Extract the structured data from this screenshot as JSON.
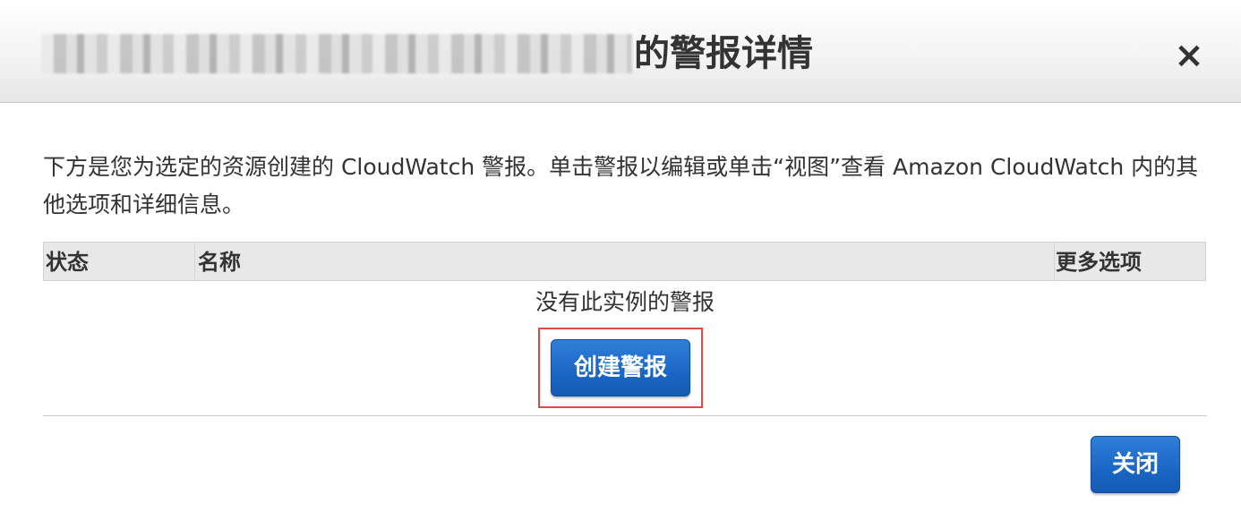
{
  "dialog": {
    "title_suffix": "的警报详情",
    "close_icon": "×"
  },
  "description": "下方是您为选定的资源创建的 CloudWatch 警报。单击警报以编辑或单击“视图”查看 Amazon CloudWatch 内的其他选项和详细信息。",
  "table": {
    "columns": [
      "状态",
      "名称",
      "更多选项"
    ]
  },
  "empty_message": "没有此实例的警报",
  "buttons": {
    "create_alarm": "创建警报",
    "close": "关闭"
  },
  "colors": {
    "primary_button": "#1a66c4",
    "highlight": "#e04848"
  }
}
